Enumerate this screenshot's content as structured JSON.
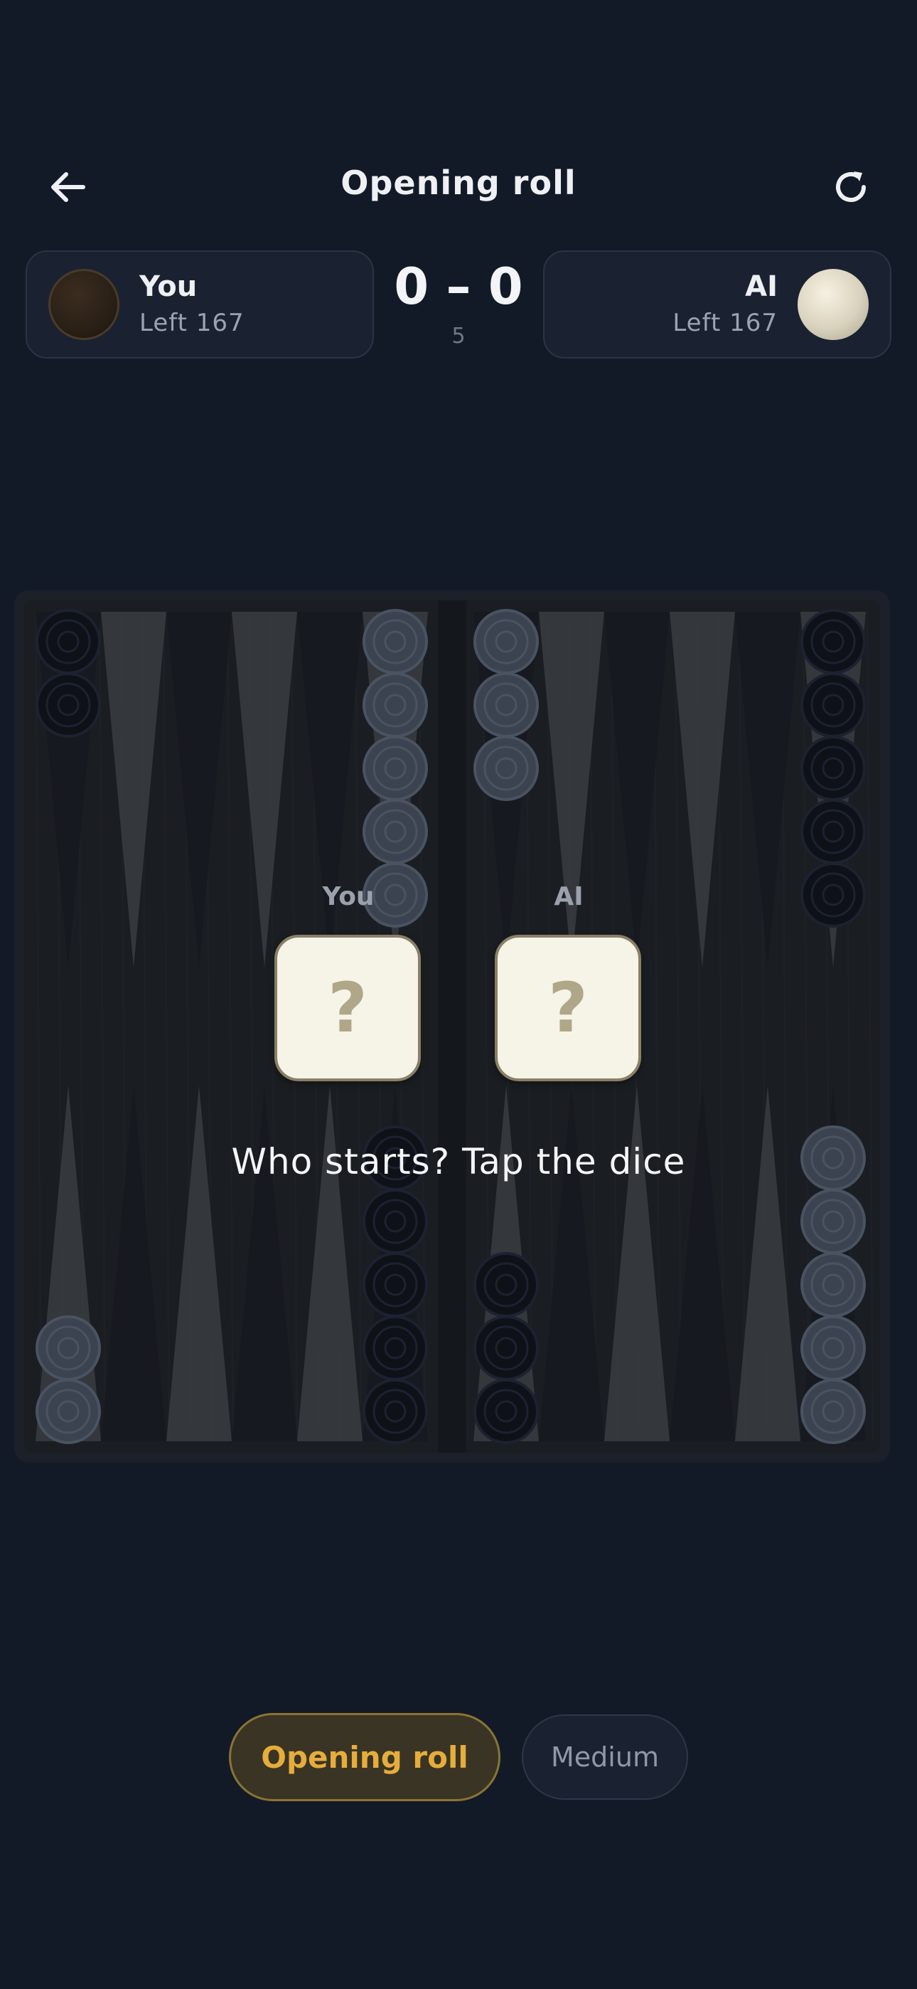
{
  "header": {
    "title": "Opening roll",
    "back_icon": "arrow-left-icon",
    "refresh_icon": "refresh-icon"
  },
  "players": {
    "you": {
      "name": "You",
      "left": "Left 167",
      "checker": "dark"
    },
    "ai": {
      "name": "AI",
      "left": "Left 167",
      "checker": "light"
    }
  },
  "score": {
    "display": "0 – 0",
    "match_length": "5"
  },
  "dice": {
    "you_label": "You",
    "ai_label": "AI",
    "you_face": "?",
    "ai_face": "?"
  },
  "prompt": "Who starts? Tap the dice",
  "footer": {
    "phase_label": "Opening roll",
    "difficulty_label": "Medium"
  },
  "board": {
    "top_points": [
      {
        "color": "dark",
        "count": 2
      },
      {
        "color": "none",
        "count": 0
      },
      {
        "color": "none",
        "count": 0
      },
      {
        "color": "none",
        "count": 0
      },
      {
        "color": "none",
        "count": 0
      },
      {
        "color": "light",
        "count": 5
      },
      {
        "color": "light",
        "count": 3
      },
      {
        "color": "none",
        "count": 0
      },
      {
        "color": "none",
        "count": 0
      },
      {
        "color": "none",
        "count": 0
      },
      {
        "color": "none",
        "count": 0
      },
      {
        "color": "dark",
        "count": 5
      }
    ],
    "bottom_points": [
      {
        "color": "light",
        "count": 2
      },
      {
        "color": "none",
        "count": 0
      },
      {
        "color": "none",
        "count": 0
      },
      {
        "color": "none",
        "count": 0
      },
      {
        "color": "none",
        "count": 0
      },
      {
        "color": "dark",
        "count": 5
      },
      {
        "color": "dark",
        "count": 3
      },
      {
        "color": "none",
        "count": 0
      },
      {
        "color": "none",
        "count": 0
      },
      {
        "color": "none",
        "count": 0
      },
      {
        "color": "none",
        "count": 0
      },
      {
        "color": "light",
        "count": 5
      }
    ],
    "colors": {
      "wood_dark": "#1a1d22",
      "triangle_light": "#3a3d42",
      "triangle_dark": "#16191e",
      "checker_dark": "#0e1118",
      "checker_light": "#3b4350"
    }
  }
}
